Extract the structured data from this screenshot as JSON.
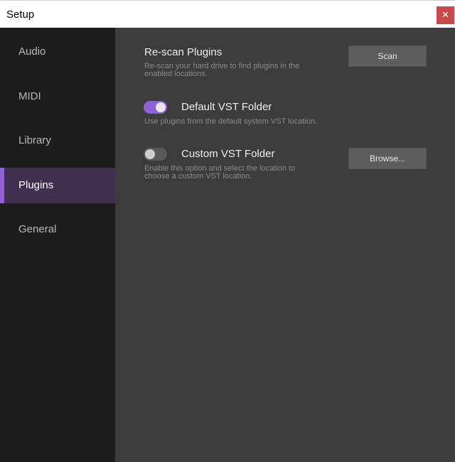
{
  "window": {
    "title": "Setup",
    "close_glyph": "✕"
  },
  "sidebar": {
    "items": [
      {
        "label": "Audio",
        "active": false
      },
      {
        "label": "MIDI",
        "active": false
      },
      {
        "label": "Library",
        "active": false
      },
      {
        "label": "Plugins",
        "active": true
      },
      {
        "label": "General",
        "active": false
      }
    ]
  },
  "plugins": {
    "rescan": {
      "title": "Re-scan Plugins",
      "description": "Re-scan your hard drive to find plugins in the enabled locations.",
      "button_label": "Scan"
    },
    "default_vst": {
      "title": "Default VST Folder",
      "description": "Use plugins from the default system VST location.",
      "enabled": true
    },
    "custom_vst": {
      "title": "Custom VST Folder",
      "description": "Enable this option and select the location to choose a custom VST location.",
      "enabled": false,
      "button_label": "Browse..."
    }
  },
  "colors": {
    "accent": "#8e5fd6",
    "sidebar_bg": "#1d1d1d",
    "content_bg": "#3c3c3c",
    "active_item_bg": "#3f3050",
    "close_button": "#c94a4a"
  }
}
